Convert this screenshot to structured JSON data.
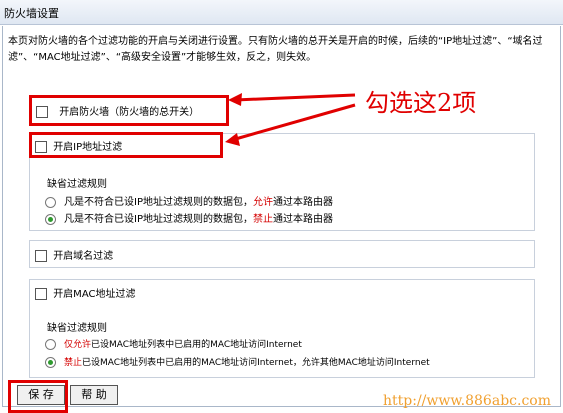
{
  "title": "防火墙设置",
  "description": "本页对防火墙的各个过滤功能的开启与关闭进行设置。只有防火墙的总开关是开启的时候，后续的“IP地址过滤”、“域名过滤”、“MAC地址过滤”、“高级安全设置”才能够生效，反之，则失效。",
  "firewall_master_label": "开启防火墙（防火墙的总开关）",
  "ip_filter": {
    "label": "开启IP地址过滤",
    "default_rule_label": "缺省过滤规则",
    "rule1_prefix": "凡是不符合已设IP地址过滤规则的数据包，",
    "rule1_highlight": "允许",
    "rule1_suffix": "通过本路由器",
    "rule2_prefix": "凡是不符合已设IP地址过滤规则的数据包，",
    "rule2_highlight": "禁止",
    "rule2_suffix": "通过本路由器"
  },
  "domain_filter": {
    "label": "开启域名过滤"
  },
  "mac_filter": {
    "label": "开启MAC地址过滤",
    "default_rule_label": "缺省过滤规则",
    "rule1_highlight": "仅允许",
    "rule1_suffix": "已设MAC地址列表中已启用的MAC地址访问Internet",
    "rule2_highlight": "禁止",
    "rule2_suffix": "已设MAC地址列表中已启用的MAC地址访问Internet，允许其他MAC地址访问Internet"
  },
  "buttons": {
    "save": "保 存",
    "help": "帮 助"
  },
  "annotation": "勾选这2项",
  "watermark": "http://www.886abc.com",
  "colors": {
    "annotation_red": "#e00000",
    "radio_selected": "#2f9a2f",
    "watermark": "#f0a030"
  }
}
